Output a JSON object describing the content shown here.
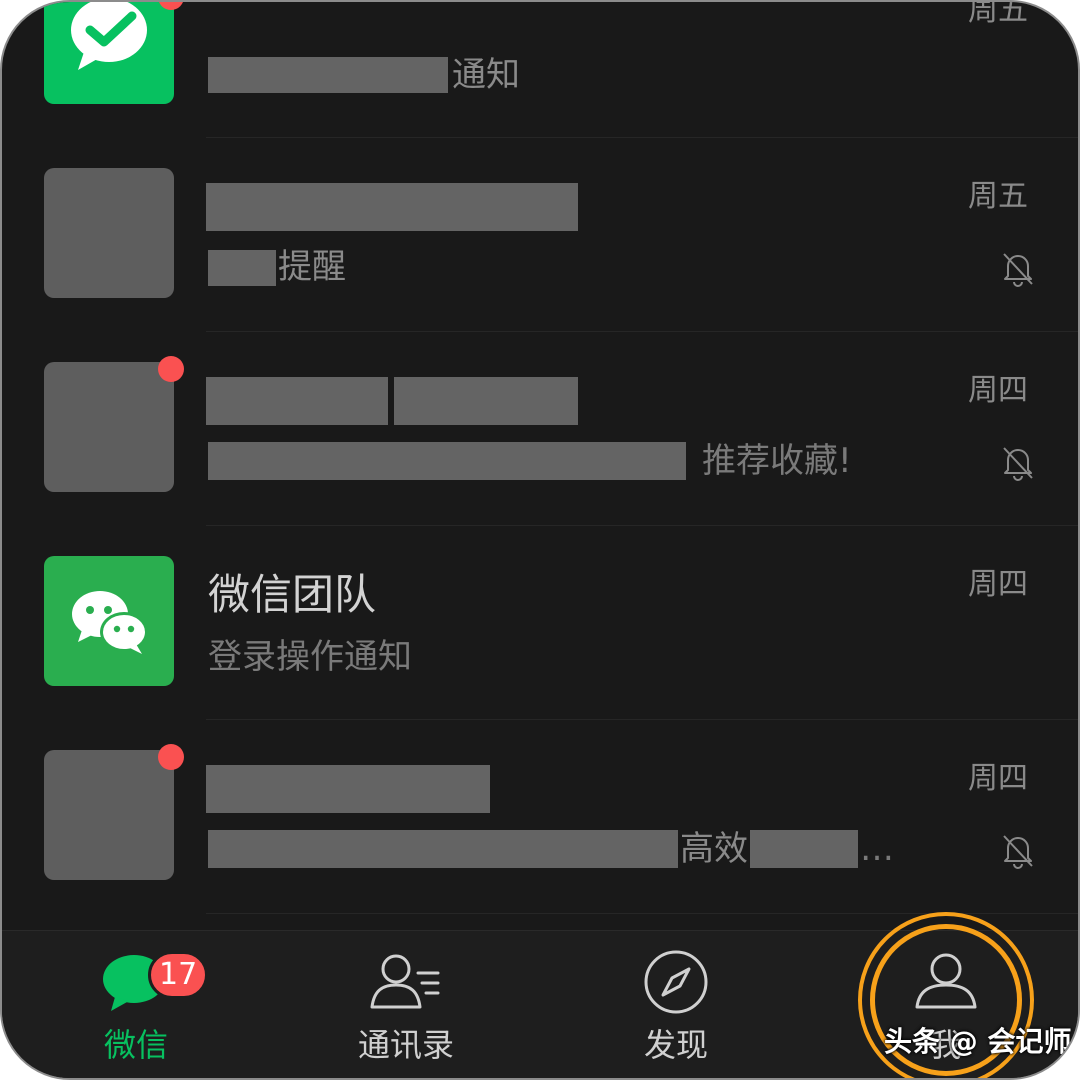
{
  "chats": [
    {
      "title": "",
      "preview_suffix": "通知",
      "time": "周五",
      "avatar": "wechat-pay-icon",
      "unread_dot": true,
      "muted": false
    },
    {
      "title": "",
      "preview_suffix": "提醒",
      "time": "周五",
      "avatar": "redacted",
      "unread_dot": false,
      "muted": true
    },
    {
      "title": "",
      "preview_suffix": "推荐收藏!",
      "time": "周四",
      "avatar": "redacted",
      "unread_dot": true,
      "muted": true
    },
    {
      "title": "微信团队",
      "preview": "登录操作通知",
      "time": "周四",
      "avatar": "wechat-team-icon",
      "unread_dot": false,
      "muted": false
    },
    {
      "title": "",
      "preview_middle": "高效",
      "preview_ellipsis": "…",
      "time": "周四",
      "avatar": "redacted",
      "unread_dot": true,
      "muted": true
    }
  ],
  "tabbar": {
    "tabs": [
      {
        "label": "微信",
        "icon": "chat-bubble-icon",
        "active": true,
        "badge": "17"
      },
      {
        "label": "通讯录",
        "icon": "contacts-icon",
        "active": false
      },
      {
        "label": "发现",
        "icon": "compass-icon",
        "active": false
      },
      {
        "label": "我",
        "icon": "person-icon",
        "active": false
      }
    ]
  },
  "watermark": "头条 @ 会记师",
  "colors": {
    "background": "#191919",
    "accent_green": "#07c160",
    "badge_red": "#fa5151",
    "highlight_orange": "#f7a11a"
  }
}
